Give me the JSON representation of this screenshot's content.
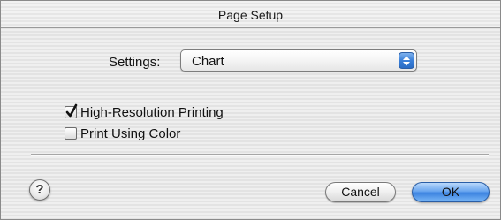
{
  "window": {
    "title": "Page Setup"
  },
  "settings": {
    "label": "Settings:",
    "selected": "Chart"
  },
  "options": [
    {
      "label": "High-Resolution Printing",
      "checked": true
    },
    {
      "label": "Print Using Color",
      "checked": false
    }
  ],
  "buttons": {
    "help": "?",
    "cancel": "Cancel",
    "ok": "OK"
  },
  "colors": {
    "accent": "#3b82e0",
    "window_bg": "#ececec"
  }
}
